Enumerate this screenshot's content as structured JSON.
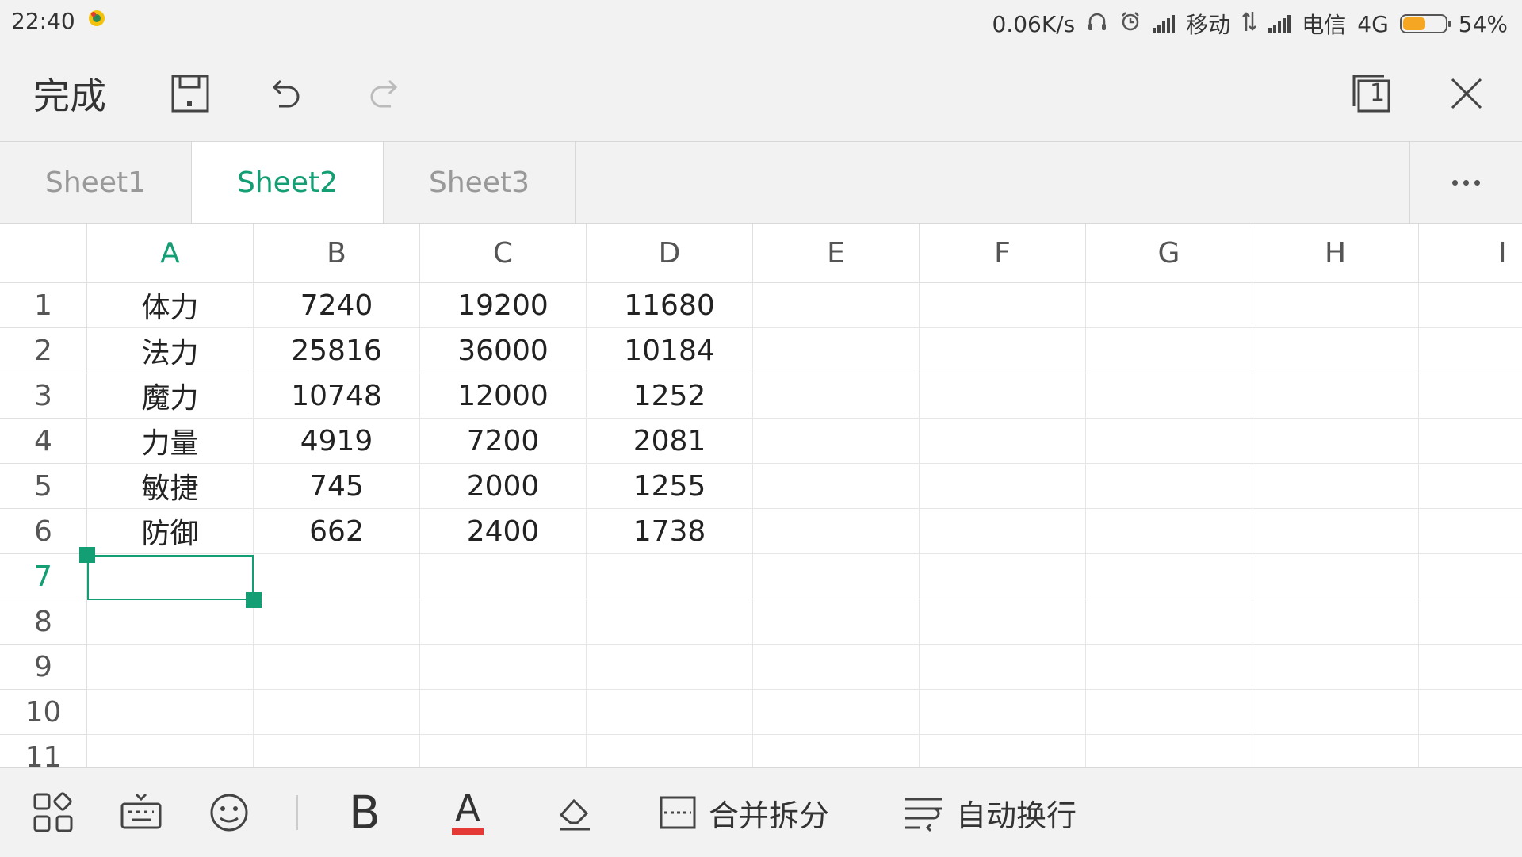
{
  "status_bar": {
    "time": "22:40",
    "net_speed": "0.06K/s",
    "carrier1": "移动",
    "carrier2": "电信",
    "network": "4G",
    "battery": "54%",
    "battery_level": 0.54,
    "battery_color": "#f5a623"
  },
  "toolbar": {
    "done_label": "完成",
    "page_count": "1"
  },
  "sheet_tabs": {
    "tabs": [
      "Sheet1",
      "Sheet2",
      "Sheet3"
    ],
    "active": "Sheet2"
  },
  "grid": {
    "columns": [
      "A",
      "B",
      "C",
      "D",
      "E",
      "F",
      "G",
      "H",
      "I"
    ],
    "rows": [
      "1",
      "2",
      "3",
      "4",
      "5",
      "6",
      "7",
      "8",
      "9",
      "10",
      "11"
    ],
    "cells": [
      [
        "体力",
        "7240",
        "19200",
        "11680"
      ],
      [
        "法力",
        "25816",
        "36000",
        "10184"
      ],
      [
        "魔力",
        "10748",
        "12000",
        "1252"
      ],
      [
        "力量",
        "4919",
        "7200",
        "2081"
      ],
      [
        "敏捷",
        "745",
        "2000",
        "1255"
      ],
      [
        "防御",
        "662",
        "2400",
        "1738"
      ]
    ],
    "selected_cell": "A7",
    "accent_color": "#149e73"
  },
  "bottom_bar": {
    "merge_label": "合并拆分",
    "wrap_label": "自动换行",
    "bold_label": "B",
    "font_color_label": "A",
    "font_color": "#e53935"
  }
}
